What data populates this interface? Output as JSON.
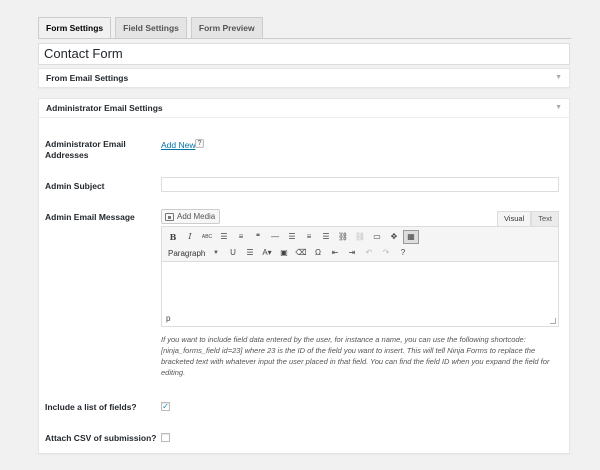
{
  "tabs": [
    "Form Settings",
    "Field Settings",
    "Form Preview"
  ],
  "form_title": "Contact Form",
  "from_email_box": {
    "title": "From Email Settings"
  },
  "admin_box": {
    "title": "Administrator Email Settings",
    "addresses_label": "Administrator Email Addresses",
    "add_new_label": "Add New",
    "help_badge": "?",
    "subject_label": "Admin Subject",
    "subject_value": "",
    "message_label": "Admin Email Message",
    "add_media_label": "Add Media",
    "editor_tabs": [
      "Visual",
      "Text"
    ],
    "active_editor_tab": "Visual",
    "format_select": "Paragraph",
    "editor_path": "p",
    "help_text": "If you want to include field data entered by the user, for instance a name, you can use the following shortcode: [ninja_forms_field id=23] where 23 is the ID of the field you want to insert. This will tell Ninja Forms to replace the bracketed text with whatever input the user placed in that field. You can find the field ID when you expand the field for editing.",
    "include_fields_label": "Include a list of fields?",
    "include_fields_checked": true,
    "attach_csv_label": "Attach CSV of submission?",
    "attach_csv_checked": false
  },
  "toolbar_row1": [
    {
      "icon": "bold-icon",
      "glyph": "B",
      "cls": "bold"
    },
    {
      "icon": "italic-icon",
      "glyph": "I",
      "cls": "ital"
    },
    {
      "icon": "strikethrough-icon",
      "glyph": "ABC",
      "cls": ""
    },
    {
      "icon": "bullet-list-icon",
      "glyph": "☰",
      "cls": ""
    },
    {
      "icon": "numbered-list-icon",
      "glyph": "≡",
      "cls": ""
    },
    {
      "icon": "blockquote-icon",
      "glyph": "❝",
      "cls": ""
    },
    {
      "icon": "horizontal-rule-icon",
      "glyph": "—",
      "cls": ""
    },
    {
      "icon": "align-left-icon",
      "glyph": "☰",
      "cls": ""
    },
    {
      "icon": "align-center-icon",
      "glyph": "≡",
      "cls": ""
    },
    {
      "icon": "align-right-icon",
      "glyph": "☰",
      "cls": ""
    },
    {
      "icon": "link-icon",
      "glyph": "⛓",
      "cls": ""
    },
    {
      "icon": "unlink-icon",
      "glyph": "⛓",
      "cls": "dim"
    },
    {
      "icon": "read-more-icon",
      "glyph": "▭",
      "cls": ""
    },
    {
      "icon": "fullscreen-icon",
      "glyph": "✥",
      "cls": ""
    },
    {
      "icon": "toolbar-toggle-icon",
      "glyph": "▦",
      "cls": "pressed"
    }
  ],
  "toolbar_row2": [
    {
      "icon": "underline-icon",
      "glyph": "U",
      "cls": ""
    },
    {
      "icon": "justify-icon",
      "glyph": "☰",
      "cls": ""
    },
    {
      "icon": "text-color-icon",
      "glyph": "A▾",
      "cls": ""
    },
    {
      "icon": "paste-text-icon",
      "glyph": "▣",
      "cls": ""
    },
    {
      "icon": "clear-formatting-icon",
      "glyph": "⌫",
      "cls": ""
    },
    {
      "icon": "special-character-icon",
      "glyph": "Ω",
      "cls": ""
    },
    {
      "icon": "outdent-icon",
      "glyph": "⇤",
      "cls": ""
    },
    {
      "icon": "indent-icon",
      "glyph": "⇥",
      "cls": ""
    },
    {
      "icon": "undo-icon",
      "glyph": "↶",
      "cls": "dim"
    },
    {
      "icon": "redo-icon",
      "glyph": "↷",
      "cls": "dim"
    },
    {
      "icon": "help-icon",
      "glyph": "?",
      "cls": ""
    }
  ]
}
